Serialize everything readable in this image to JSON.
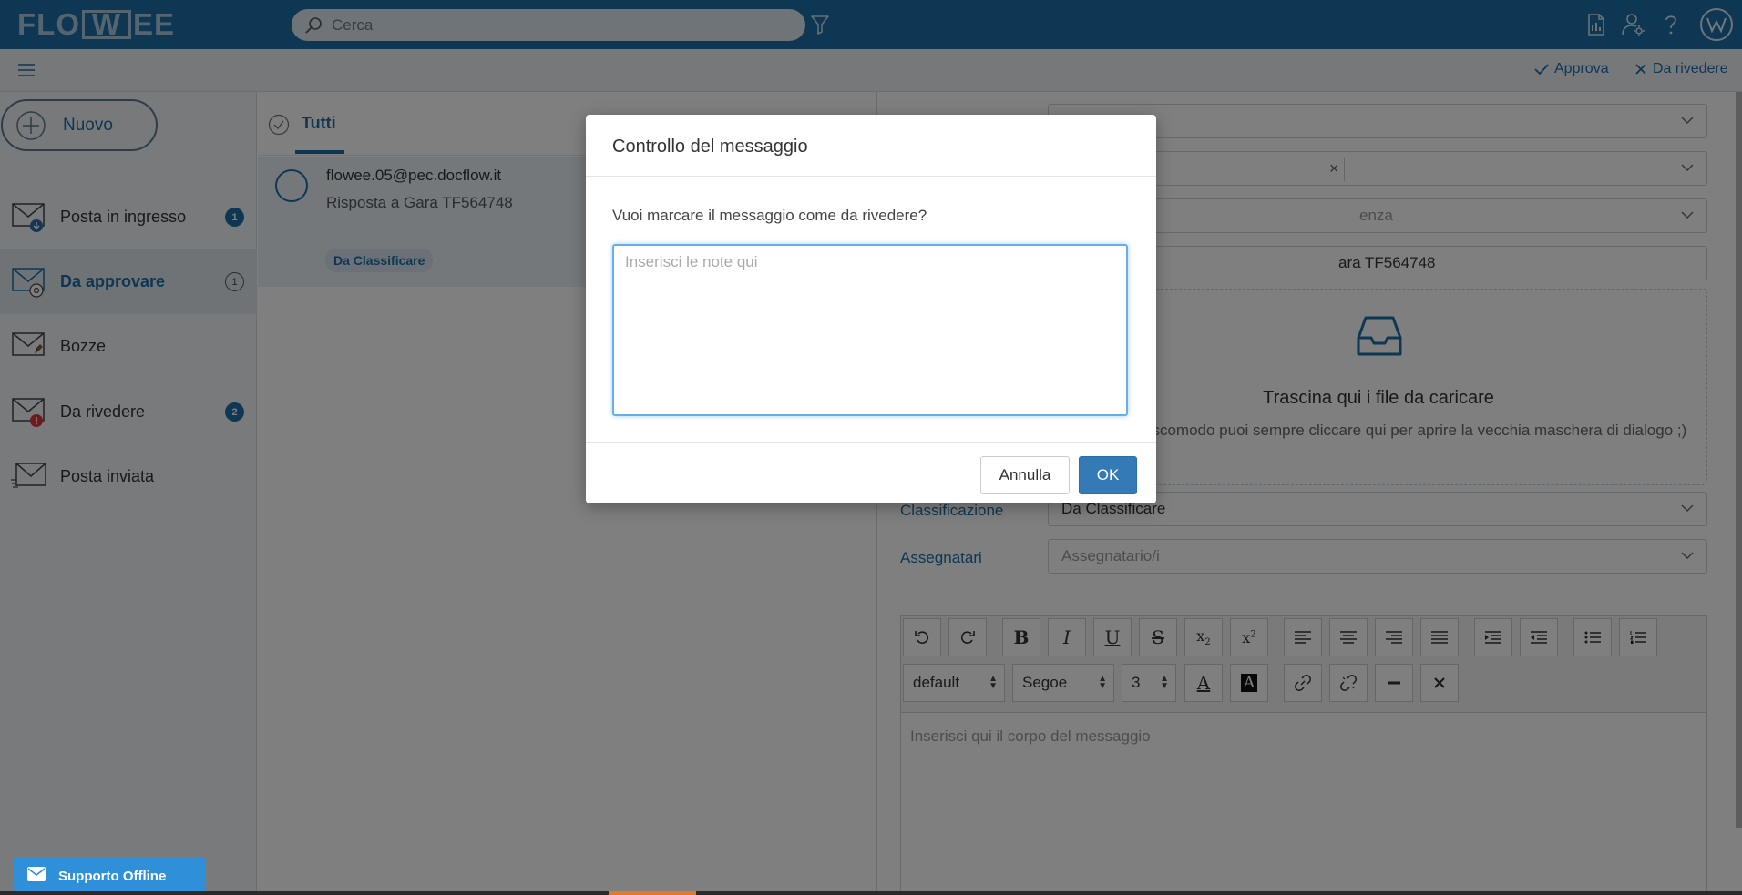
{
  "header": {
    "logo": [
      "FLO",
      "W",
      "EE"
    ],
    "search_placeholder": "Cerca"
  },
  "subbar": {
    "approve_label": "Approva",
    "review_label": "Da rivedere"
  },
  "sidebar": {
    "new_label": "Nuovo",
    "items": [
      {
        "label": "Posta in ingresso",
        "badge": "1"
      },
      {
        "label": "Da approvare",
        "badge": "1"
      },
      {
        "label": "Bozze",
        "badge": ""
      },
      {
        "label": "Da rivedere",
        "badge": "2"
      },
      {
        "label": "Posta inviata",
        "badge": ""
      }
    ]
  },
  "list": {
    "tab_label": "Tutti",
    "message": {
      "from": "flowee.05@pec.docflow.it",
      "subject": "Risposta a Gara TF564748",
      "tag": "Da Classificare"
    }
  },
  "form": {
    "chip_close": "×",
    "field3_placeholder_fragment": "enza",
    "field4_value_fragment": "ara TF564748",
    "dropzone_title": "Trascina qui i file da caricare",
    "dropzone_sub": "file ti risulta scomodo puoi sempre cliccare qui per aprire la vecchia maschera di dialogo ;)",
    "classificazione_label": "Classificazione",
    "classificazione_value": "Da Classificare",
    "assegnatari_label": "Assegnatari",
    "assegnatari_placeholder": "Assegnatario/i",
    "editor": {
      "style_select": "default",
      "font_select": "Segoe",
      "size_select": "3",
      "body_placeholder": "Inserisci qui il corpo del messaggio"
    }
  },
  "modal": {
    "title": "Controllo del messaggio",
    "question": "Vuoi marcare il messaggio come da rivedere?",
    "notes_placeholder": "Inserisci le note qui",
    "cancel_label": "Annulla",
    "ok_label": "OK"
  },
  "support": {
    "label": "Supporto Offline"
  }
}
